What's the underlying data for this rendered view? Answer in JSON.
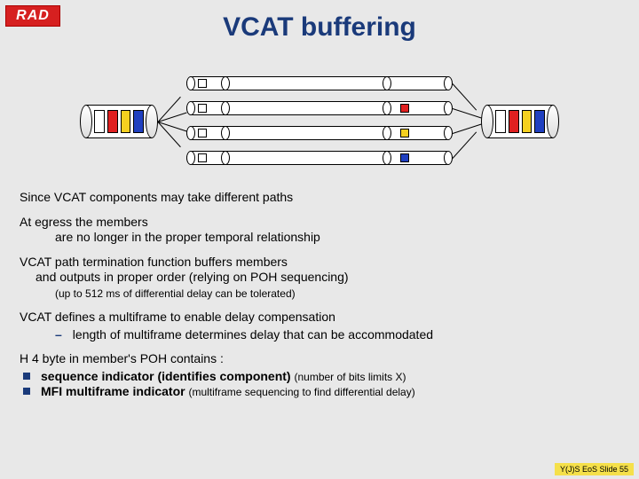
{
  "logo": "RAD",
  "title": "VCAT buffering",
  "body": {
    "p1": "Since VCAT components may take different paths",
    "p2a": "At egress the members",
    "p2b": "are no longer in the proper temporal relationship",
    "p3a": "VCAT path termination function buffers members",
    "p3b": "and outputs in proper order (relying on POH sequencing)",
    "p3c": "(up to 512 ms of differential delay can be tolerated)",
    "p4": "VCAT defines a multiframe to enable delay compensation",
    "p4a": "length of multiframe determines delay that can be accommodated",
    "p5": "H 4 byte in member's POH contains :",
    "p5a": "sequence indicator (identifies component) ",
    "p5a_sub": "(number of bits limits X)",
    "p5b": "MFI multiframe indicator ",
    "p5b_sub": "(multiframe sequencing to find differential delay)"
  },
  "footer": "Y(J)S EoS  Slide 55"
}
